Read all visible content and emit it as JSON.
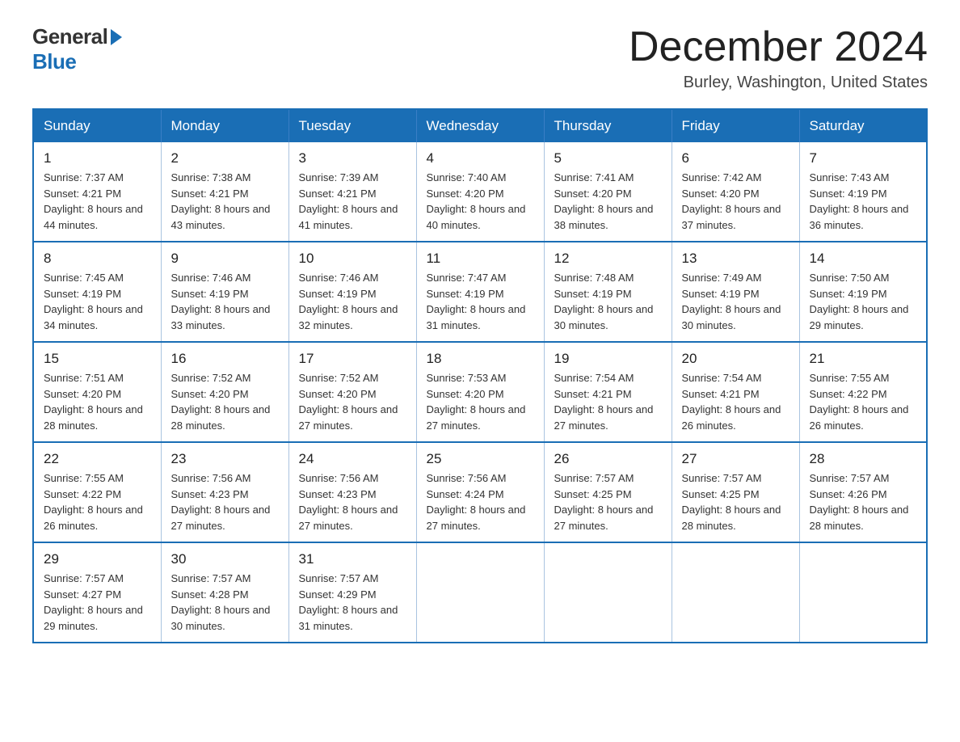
{
  "logo": {
    "general": "General",
    "blue": "Blue"
  },
  "title": "December 2024",
  "location": "Burley, Washington, United States",
  "days_of_week": [
    "Sunday",
    "Monday",
    "Tuesday",
    "Wednesday",
    "Thursday",
    "Friday",
    "Saturday"
  ],
  "weeks": [
    [
      {
        "day": "1",
        "sunrise": "7:37 AM",
        "sunset": "4:21 PM",
        "daylight": "8 hours and 44 minutes."
      },
      {
        "day": "2",
        "sunrise": "7:38 AM",
        "sunset": "4:21 PM",
        "daylight": "8 hours and 43 minutes."
      },
      {
        "day": "3",
        "sunrise": "7:39 AM",
        "sunset": "4:21 PM",
        "daylight": "8 hours and 41 minutes."
      },
      {
        "day": "4",
        "sunrise": "7:40 AM",
        "sunset": "4:20 PM",
        "daylight": "8 hours and 40 minutes."
      },
      {
        "day": "5",
        "sunrise": "7:41 AM",
        "sunset": "4:20 PM",
        "daylight": "8 hours and 38 minutes."
      },
      {
        "day": "6",
        "sunrise": "7:42 AM",
        "sunset": "4:20 PM",
        "daylight": "8 hours and 37 minutes."
      },
      {
        "day": "7",
        "sunrise": "7:43 AM",
        "sunset": "4:19 PM",
        "daylight": "8 hours and 36 minutes."
      }
    ],
    [
      {
        "day": "8",
        "sunrise": "7:45 AM",
        "sunset": "4:19 PM",
        "daylight": "8 hours and 34 minutes."
      },
      {
        "day": "9",
        "sunrise": "7:46 AM",
        "sunset": "4:19 PM",
        "daylight": "8 hours and 33 minutes."
      },
      {
        "day": "10",
        "sunrise": "7:46 AM",
        "sunset": "4:19 PM",
        "daylight": "8 hours and 32 minutes."
      },
      {
        "day": "11",
        "sunrise": "7:47 AM",
        "sunset": "4:19 PM",
        "daylight": "8 hours and 31 minutes."
      },
      {
        "day": "12",
        "sunrise": "7:48 AM",
        "sunset": "4:19 PM",
        "daylight": "8 hours and 30 minutes."
      },
      {
        "day": "13",
        "sunrise": "7:49 AM",
        "sunset": "4:19 PM",
        "daylight": "8 hours and 30 minutes."
      },
      {
        "day": "14",
        "sunrise": "7:50 AM",
        "sunset": "4:19 PM",
        "daylight": "8 hours and 29 minutes."
      }
    ],
    [
      {
        "day": "15",
        "sunrise": "7:51 AM",
        "sunset": "4:20 PM",
        "daylight": "8 hours and 28 minutes."
      },
      {
        "day": "16",
        "sunrise": "7:52 AM",
        "sunset": "4:20 PM",
        "daylight": "8 hours and 28 minutes."
      },
      {
        "day": "17",
        "sunrise": "7:52 AM",
        "sunset": "4:20 PM",
        "daylight": "8 hours and 27 minutes."
      },
      {
        "day": "18",
        "sunrise": "7:53 AM",
        "sunset": "4:20 PM",
        "daylight": "8 hours and 27 minutes."
      },
      {
        "day": "19",
        "sunrise": "7:54 AM",
        "sunset": "4:21 PM",
        "daylight": "8 hours and 27 minutes."
      },
      {
        "day": "20",
        "sunrise": "7:54 AM",
        "sunset": "4:21 PM",
        "daylight": "8 hours and 26 minutes."
      },
      {
        "day": "21",
        "sunrise": "7:55 AM",
        "sunset": "4:22 PM",
        "daylight": "8 hours and 26 minutes."
      }
    ],
    [
      {
        "day": "22",
        "sunrise": "7:55 AM",
        "sunset": "4:22 PM",
        "daylight": "8 hours and 26 minutes."
      },
      {
        "day": "23",
        "sunrise": "7:56 AM",
        "sunset": "4:23 PM",
        "daylight": "8 hours and 27 minutes."
      },
      {
        "day": "24",
        "sunrise": "7:56 AM",
        "sunset": "4:23 PM",
        "daylight": "8 hours and 27 minutes."
      },
      {
        "day": "25",
        "sunrise": "7:56 AM",
        "sunset": "4:24 PM",
        "daylight": "8 hours and 27 minutes."
      },
      {
        "day": "26",
        "sunrise": "7:57 AM",
        "sunset": "4:25 PM",
        "daylight": "8 hours and 27 minutes."
      },
      {
        "day": "27",
        "sunrise": "7:57 AM",
        "sunset": "4:25 PM",
        "daylight": "8 hours and 28 minutes."
      },
      {
        "day": "28",
        "sunrise": "7:57 AM",
        "sunset": "4:26 PM",
        "daylight": "8 hours and 28 minutes."
      }
    ],
    [
      {
        "day": "29",
        "sunrise": "7:57 AM",
        "sunset": "4:27 PM",
        "daylight": "8 hours and 29 minutes."
      },
      {
        "day": "30",
        "sunrise": "7:57 AM",
        "sunset": "4:28 PM",
        "daylight": "8 hours and 30 minutes."
      },
      {
        "day": "31",
        "sunrise": "7:57 AM",
        "sunset": "4:29 PM",
        "daylight": "8 hours and 31 minutes."
      },
      null,
      null,
      null,
      null
    ]
  ]
}
